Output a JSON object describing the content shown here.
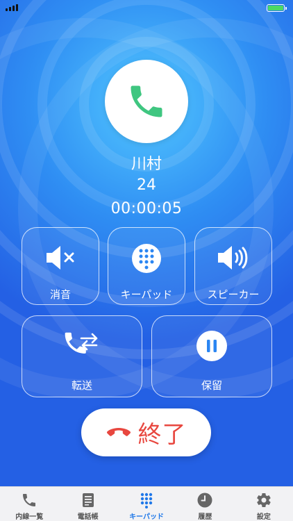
{
  "call": {
    "name": "川村",
    "extension": "24",
    "duration": "00:00:05"
  },
  "controls": {
    "mute": "消音",
    "keypad": "キーパッド",
    "speaker": "スピーカー",
    "transfer": "転送",
    "hold": "保留"
  },
  "end_call": "終了",
  "tabs": [
    {
      "label": "内線一覧",
      "icon": "phone-icon"
    },
    {
      "label": "電話帳",
      "icon": "address-book-icon"
    },
    {
      "label": "キーパッド",
      "icon": "keypad-icon"
    },
    {
      "label": "履歴",
      "icon": "clock-icon"
    },
    {
      "label": "設定",
      "icon": "gear-icon"
    }
  ],
  "colors": {
    "accent": "#1f78e8",
    "phone_green": "#3fc680",
    "end_red": "#e8473f",
    "battery": "#4cd964"
  }
}
